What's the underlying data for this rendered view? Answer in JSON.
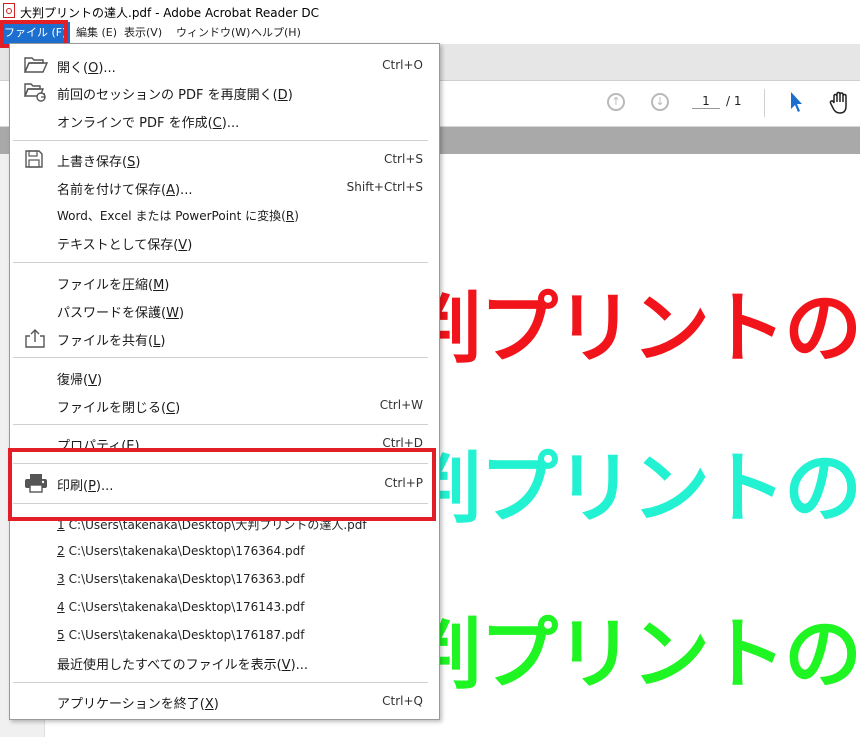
{
  "window": {
    "title": "大判プリントの達人.pdf - Adobe Acrobat Reader DC"
  },
  "menubar": {
    "items": [
      {
        "label": "ファイル (F)"
      },
      {
        "label": "編集 (E)"
      },
      {
        "label": "表示(V)"
      },
      {
        "label": "ウィンドウ(W)"
      },
      {
        "label": "ヘルプ(H)"
      }
    ]
  },
  "toolbar": {
    "page_current": "1",
    "page_total": "/ 1",
    "icons": [
      "page-up-icon",
      "page-down-icon",
      "select-tool-icon",
      "hand-tool-icon"
    ]
  },
  "document": {
    "lines": [
      {
        "text": "大判プリントの達人",
        "color": "#f2141b"
      },
      {
        "text": "大判プリントの達人",
        "color": "#22f2d2"
      },
      {
        "text": "大判プリントの達人",
        "color": "#1ef522"
      }
    ]
  },
  "file_menu": {
    "open": {
      "label": "開く(",
      "acc": "O",
      "rest": ")...",
      "shortcut": "Ctrl+O",
      "icon": "folder-open-icon"
    },
    "reopen": {
      "label": "前回のセッションの PDF を再度開く(",
      "acc": "D",
      "rest": ")",
      "icon": "reopen-session-icon"
    },
    "create": {
      "label": "オンラインで PDF を作成(",
      "acc": "C",
      "rest": ")..."
    },
    "save": {
      "label": "上書き保存(",
      "acc": "S",
      "rest": ")",
      "shortcut": "Ctrl+S",
      "icon": "save-icon"
    },
    "save_as": {
      "label": "名前を付けて保存(",
      "acc": "A",
      "rest": ")...",
      "shortcut": "Shift+Ctrl+S"
    },
    "convert": {
      "label": "Word、Excel または PowerPoint に変換(",
      "acc": "R",
      "rest": ")"
    },
    "save_text": {
      "label": "テキストとして保存(",
      "acc": "V",
      "rest": ")"
    },
    "compress": {
      "label": "ファイルを圧縮(",
      "acc": "M",
      "rest": ")"
    },
    "protect": {
      "label": "パスワードを保護(",
      "acc": "W",
      "rest": ")"
    },
    "share": {
      "label": "ファイルを共有(",
      "acc": "L",
      "rest": ")",
      "icon": "share-icon"
    },
    "revert": {
      "label": "復帰(",
      "acc": "V",
      "rest": ")"
    },
    "close": {
      "label": "ファイルを閉じる(",
      "acc": "C",
      "rest": ")",
      "shortcut": "Ctrl+W"
    },
    "properties": {
      "label": "プロパティ(",
      "acc": "E",
      "rest": ")",
      "shortcut": "Ctrl+D"
    },
    "print": {
      "label": "印刷(",
      "acc": "P",
      "rest": ")...",
      "shortcut": "Ctrl+P",
      "icon": "printer-icon"
    },
    "recent": [
      {
        "num": "1",
        "path": "C:\\Users\\takenaka\\Desktop\\大判プリントの達人.pdf"
      },
      {
        "num": "2",
        "path": "C:\\Users\\takenaka\\Desktop\\176364.pdf"
      },
      {
        "num": "3",
        "path": "C:\\Users\\takenaka\\Desktop\\176363.pdf"
      },
      {
        "num": "4",
        "path": "C:\\Users\\takenaka\\Desktop\\176143.pdf"
      },
      {
        "num": "5",
        "path": "C:\\Users\\takenaka\\Desktop\\176187.pdf"
      }
    ],
    "show_all": {
      "label": "最近使用したすべてのファイルを表示(",
      "acc": "V",
      "rest": ")..."
    },
    "exit": {
      "label": "アプリケーションを終了(",
      "acc": "X",
      "rest": ")",
      "shortcut": "Ctrl+Q"
    }
  },
  "colors": {
    "menu_active": "#1d6fcf",
    "highlight_frame": "#e21f26"
  }
}
